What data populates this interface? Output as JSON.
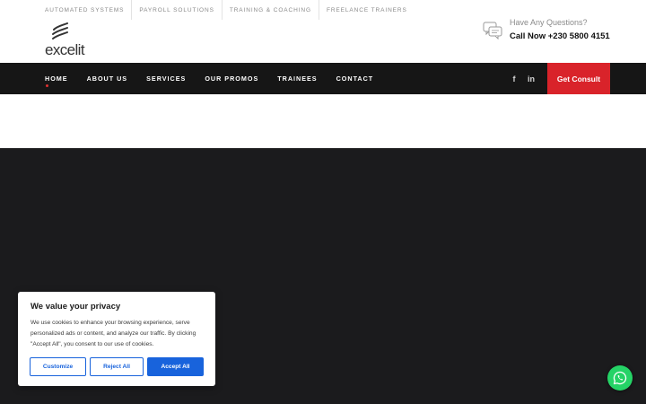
{
  "topbar": {
    "links": [
      "AUTOMATED SYSTEMS",
      "PAYROLL SOLUTIONS",
      "TRAINING & COACHING",
      "FREELANCE TRAINERS"
    ]
  },
  "logo": {
    "text": "excelit",
    "icon": "flame-logo-icon"
  },
  "contact": {
    "question": "Have Any Questions?",
    "phone": "Call Now +230 5800 4151",
    "icon": "chat-bubbles-icon"
  },
  "nav": {
    "items": [
      "HOME",
      "ABOUT US",
      "SERVICES",
      "OUR PROMOS",
      "TRAINEES",
      "CONTACT"
    ],
    "active": "HOME",
    "social": {
      "facebook": "f",
      "linkedin": "in"
    },
    "cta": "Get Consult"
  },
  "cookie": {
    "title": "We value your privacy",
    "body": "We use cookies to enhance your browsing experience, serve personalized ads or content, and analyze our traffic. By clicking \"Accept All\", you consent to our use of cookies.",
    "customize": "Customize",
    "reject": "Reject All",
    "accept": "Accept All"
  },
  "colors": {
    "accent": "#d9232a",
    "nav_bg": "#161616",
    "hero_bg": "#1b1b1d",
    "cookie_button": "#1863dc",
    "whatsapp": "#25d366"
  },
  "whatsapp": {
    "icon": "whatsapp-icon"
  }
}
